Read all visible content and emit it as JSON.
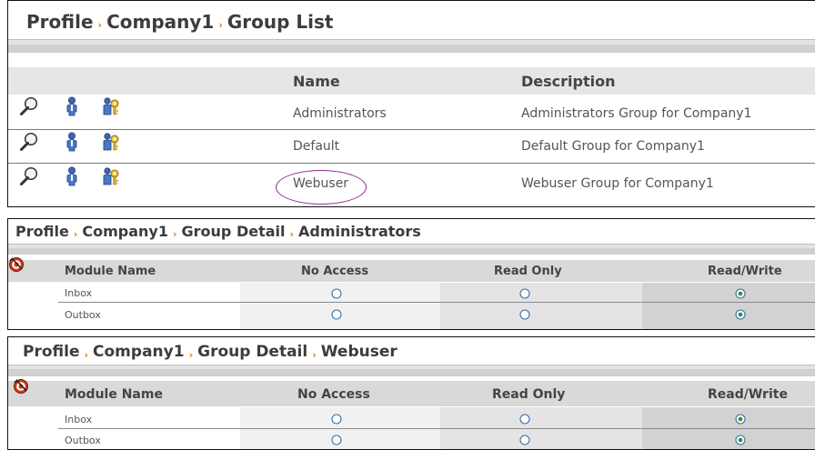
{
  "group_list": {
    "breadcrumb": [
      "Profile",
      "Company1",
      "Group List"
    ],
    "separator": "›",
    "columns": {
      "name": "Name",
      "description": "Description"
    },
    "rows": [
      {
        "name": "Administrators",
        "description": "Administrators Group for Company1"
      },
      {
        "name": "Default",
        "description": "Default Group for Company1"
      },
      {
        "name": "Webuser",
        "description": "Webuser Group for Company1",
        "highlighted": true
      }
    ],
    "row_icons": [
      "magnifier-icon",
      "user-icon",
      "group-key-icon"
    ],
    "highlight_color": "#8b2b8b"
  },
  "detail_admin": {
    "breadcrumb": [
      "Profile",
      "Company1",
      "Group Detail",
      "Administrators"
    ],
    "columns": {
      "module": "Module Name",
      "no_access": "No Access",
      "read_only": "Read Only",
      "read_write": "Read/Write"
    },
    "rows": [
      {
        "module": "Inbox",
        "selected": "read_write"
      },
      {
        "module": "Outbox",
        "selected": "read_write"
      }
    ]
  },
  "detail_webuser": {
    "breadcrumb": [
      "Profile",
      "Company1",
      "Group Detail",
      "Webuser"
    ],
    "columns": {
      "module": "Module Name",
      "no_access": "No Access",
      "read_only": "Read Only",
      "read_write": "Read/Write"
    },
    "rows": [
      {
        "module": "Inbox",
        "selected": "read_write"
      },
      {
        "module": "Outbox",
        "selected": "read_write"
      }
    ]
  },
  "colors": {
    "separator": "#e0771a",
    "radio_blue": "#3a6ea5",
    "radio_fill": "#2f8f2f"
  }
}
